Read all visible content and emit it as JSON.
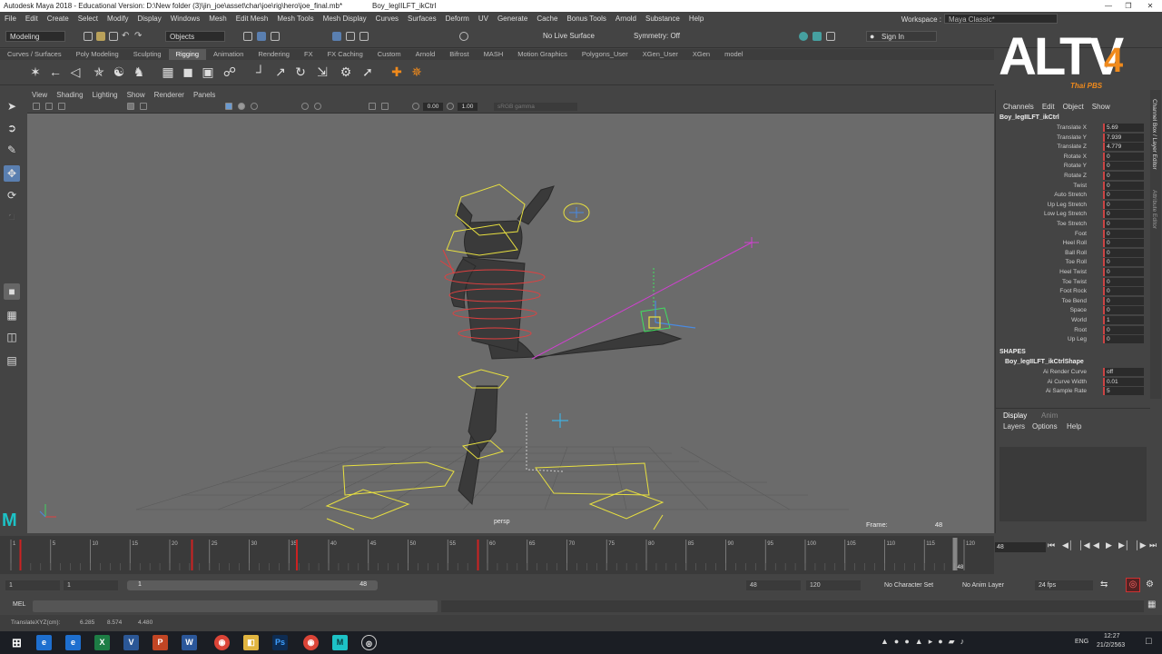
{
  "window": {
    "title": "Autodesk Maya 2018 - Educational Version: D:\\New folder (3)\\jin_joe\\asset\\char\\joe\\rig\\hero\\joe_final.mb*",
    "selection": "Boy_legIILFT_ikCtrl"
  },
  "menubar": {
    "items": [
      "File",
      "Edit",
      "Create",
      "Select",
      "Modify",
      "Display",
      "Windows",
      "Mesh",
      "Edit Mesh",
      "Mesh Tools",
      "Mesh Display",
      "Curves",
      "Surfaces",
      "Deform",
      "UV",
      "Generate",
      "Cache",
      "Bonus Tools",
      "Arnold",
      "Substance",
      "Help"
    ],
    "workspace_label": "Workspace :",
    "workspace_value": "Maya Classic*"
  },
  "statusline": {
    "mode": "Modeling",
    "objects": "Objects",
    "live_surface": "No Live Surface",
    "symmetry": "Symmetry: Off",
    "sign_in": "Sign In"
  },
  "shelf": {
    "tabs": [
      "Curves / Surfaces",
      "Poly Modeling",
      "Sculpting",
      "Rigging",
      "Animation",
      "Rendering",
      "FX",
      "FX Caching",
      "Custom",
      "Arnold",
      "Bifrost",
      "MASH",
      "Motion Graphics",
      "Polygons_User",
      "XGen_User",
      "XGen",
      "model"
    ],
    "active_tab": "Rigging"
  },
  "viewport": {
    "menu": [
      "View",
      "Shading",
      "Lighting",
      "Show",
      "Renderer",
      "Panels"
    ],
    "field_a": "0.00",
    "field_b": "1.00",
    "color_space": "sRGB gamma",
    "frame_label": "Frame:",
    "frame_value": "48",
    "object_label": "persp"
  },
  "channel_box": {
    "menu": [
      "Channels",
      "Edit",
      "Object",
      "Show"
    ],
    "node": "Boy_legIILFT_ikCtrl",
    "attributes": [
      {
        "name": "Translate X",
        "value": "5.69"
      },
      {
        "name": "Translate Y",
        "value": "7.939"
      },
      {
        "name": "Translate Z",
        "value": "4.779"
      },
      {
        "name": "Rotate X",
        "value": "0"
      },
      {
        "name": "Rotate Y",
        "value": "0"
      },
      {
        "name": "Rotate Z",
        "value": "0"
      },
      {
        "name": "Twist",
        "value": "0"
      },
      {
        "name": "Auto Stretch",
        "value": "0"
      },
      {
        "name": "Up Leg Stretch",
        "value": "0"
      },
      {
        "name": "Low Leg Stretch",
        "value": "0"
      },
      {
        "name": "Toe Stretch",
        "value": "0"
      },
      {
        "name": "Foot",
        "value": "0"
      },
      {
        "name": "Heel Roll",
        "value": "0"
      },
      {
        "name": "Ball Roll",
        "value": "0"
      },
      {
        "name": "Toe Roll",
        "value": "0"
      },
      {
        "name": "Heel Twist",
        "value": "0"
      },
      {
        "name": "Toe Twist",
        "value": "0"
      },
      {
        "name": "Foot Rock",
        "value": "0"
      },
      {
        "name": "Toe Bend",
        "value": "0"
      },
      {
        "name": "Space",
        "value": "0"
      },
      {
        "name": "World",
        "value": "1"
      },
      {
        "name": "Root",
        "value": "0"
      },
      {
        "name": "Up Leg",
        "value": "0"
      }
    ],
    "shapes_header": "SHAPES",
    "shape_node": "Boy_legIILFT_ikCtrlShape",
    "shape_attributes": [
      {
        "name": "Ai Render Curve",
        "value": "off"
      },
      {
        "name": "Ai Curve Width",
        "value": "0.01"
      },
      {
        "name": "Ai Sample Rate",
        "value": "5"
      }
    ],
    "side_tabs": [
      "Channel Box / Layer Editor",
      "Attribute Editor"
    ]
  },
  "layer_editor": {
    "tabs": [
      "Display",
      "Anim"
    ],
    "menu": [
      "Layers",
      "Options",
      "Help"
    ]
  },
  "timeline": {
    "ticks": [
      "1",
      "5",
      "10",
      "15",
      "20",
      "25",
      "30",
      "35",
      "40",
      "45",
      "50",
      "55",
      "60",
      "65",
      "70",
      "75",
      "80",
      "85",
      "90",
      "95",
      "100",
      "105",
      "110",
      "115",
      "120"
    ],
    "key_frames_fraction": [
      0.01,
      0.19,
      0.3,
      0.49
    ],
    "current_frame_fraction": 0.99,
    "current_frame": "48",
    "current_frame_field": "48"
  },
  "range": {
    "start": "1",
    "start2": "1",
    "slider_start": "1",
    "slider_end": "48",
    "end": "48",
    "end2": "120",
    "character_set": "No Character Set",
    "anim_layer": "No Anim Layer",
    "fps": "24 fps"
  },
  "cmdline": {
    "label": "MEL"
  },
  "helpline": {
    "label": "TranslateXYZ(cm):",
    "x": "6.285",
    "y": "8.574",
    "z": "4.480"
  },
  "logo": {
    "main": "ALTV",
    "num": "4",
    "sub": "Thai PBS"
  },
  "taskbar": {
    "lang": "ENG",
    "time": "12:27",
    "date": "21/2/2563"
  },
  "colors": {
    "viewport_bg": "#6b6b6b",
    "control_yellow": "#e8e040",
    "control_red": "#e04040",
    "ik_green": "#40e060",
    "keyframe_red": "#cc2222",
    "logo_orange": "#f08a1c"
  }
}
